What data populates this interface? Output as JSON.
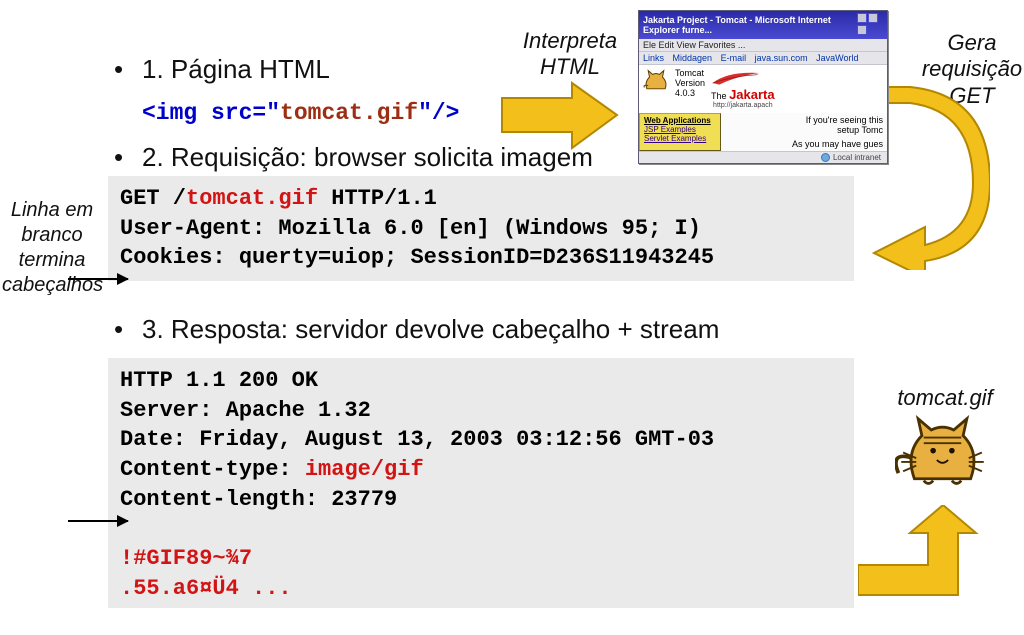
{
  "bullets": {
    "b1": "1. Página HTML",
    "b2": "2. Requisição: browser solicita imagem",
    "b3": "3. Resposta: servidor devolve cabeçalho + stream"
  },
  "codeInline": {
    "open": "<img src=\"",
    "file": "tomcat.gif",
    "close": "\"/>"
  },
  "request": {
    "l1a": "GET /",
    "l1b": "tomcat.gif",
    "l1c": " HTTP/1.1",
    "l2": "User-Agent: Mozilla 6.0 [en] (Windows 95; I)",
    "l3": "Cookies: querty=uiop; SessionID=D236S11943245",
    "l4": ""
  },
  "response": {
    "l1": "HTTP 1.1 200 OK",
    "l2": "Server: Apache 1.32",
    "l3": "Date: Friday, August 13, 2003 03:12:56 GMT-03",
    "l4a": "Content-type: ",
    "l4b": "image/gif",
    "l5": "Content-length: 23779",
    "l6": "",
    "l7": "!#GIF89~¾7",
    "l8": ".55.a6¤Ü4 ..."
  },
  "sideLabelLines": {
    "a": "Linha em",
    "b": "branco",
    "c": "termina",
    "d": "cabeçalhos"
  },
  "anno": {
    "interpret1": "Interpreta",
    "interpret2": "HTML",
    "gen1": "Gera",
    "gen2": "requisição",
    "gen3": "GET",
    "tomcatgif": "tomcat.gif"
  },
  "browser": {
    "title": "Jakarta Project - Tomcat - Microsoft Internet Explorer furne...",
    "menu": "Ele  Edit  View  Favorites  ...",
    "linksLabel": "Links",
    "links": [
      "Middagen",
      "E-mail",
      "java.sun.com",
      "JavaWorld"
    ],
    "tomcatLabel": "Tomcat",
    "versionLabel": "Version",
    "version": "4.0.3",
    "brandThe": "The",
    "brandJakarta": "Jakarta",
    "brandUrl": "http://jakarta.apach",
    "webappsHeader": "Web Applications",
    "webappsLinks": [
      "JSP Examples",
      "Servlet Examples"
    ],
    "seeing": "If you're seeing this",
    "setup": "setup Tomc",
    "mayhave": "As you may have gues",
    "status": "Local intranet"
  }
}
